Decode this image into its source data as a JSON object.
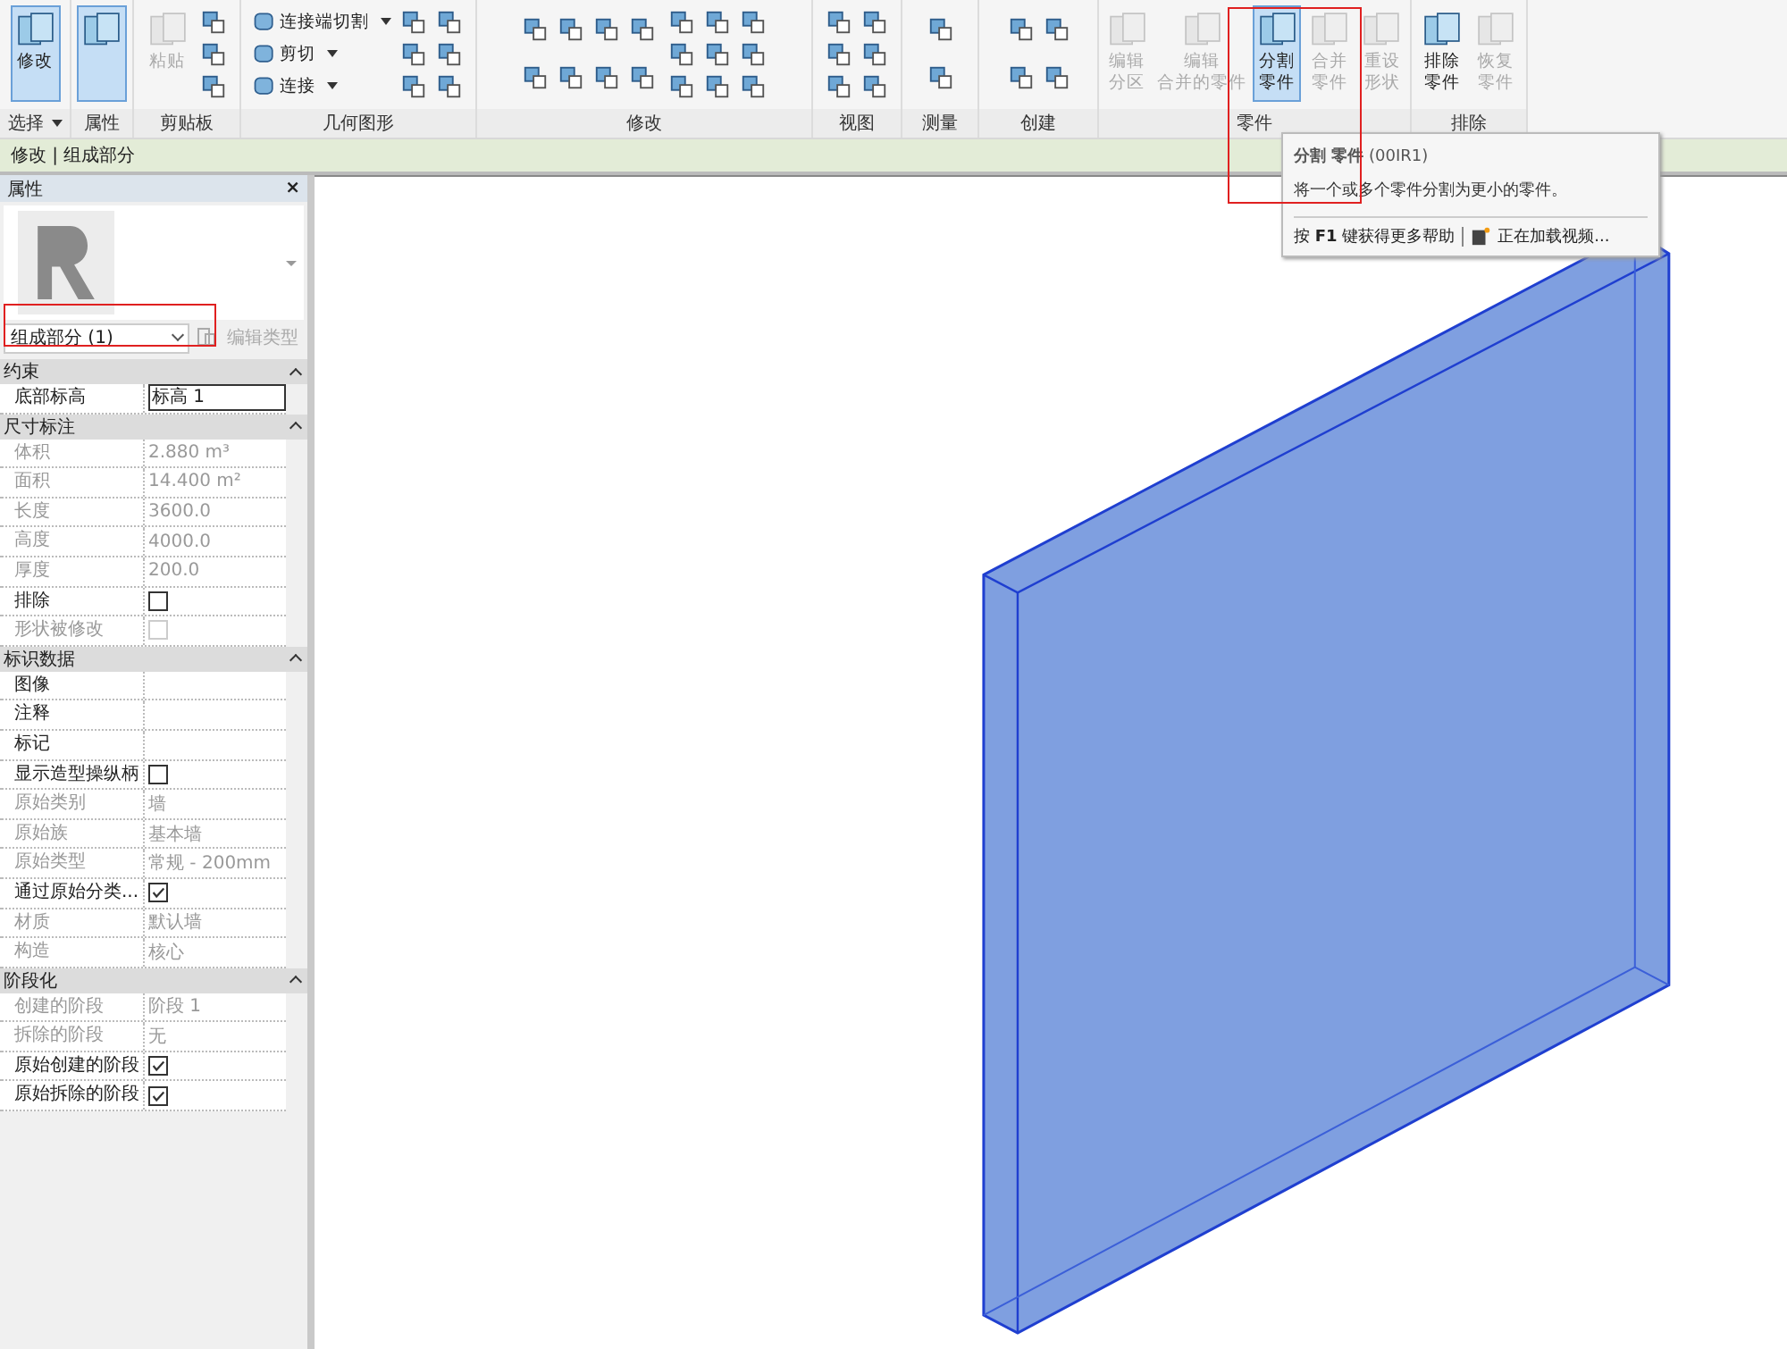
{
  "ribbon": {
    "groups": [
      {
        "label": "选择",
        "dropdown": true,
        "tools": [
          {
            "kind": "large",
            "lines": [
              "修改"
            ],
            "selected": true,
            "disabled": false
          }
        ]
      },
      {
        "label": "属性",
        "tools": [
          {
            "kind": "large",
            "selected": true,
            "disabled": false
          }
        ]
      },
      {
        "label": "剪贴板",
        "tools": [
          {
            "kind": "large",
            "lines": [
              "粘贴"
            ],
            "selected": false,
            "disabled": true
          }
        ]
      },
      {
        "label": "几何图形",
        "tools": [
          {
            "kind": "small",
            "items": [
              {
                "label": "连接端切割",
                "disabled": false
              },
              {
                "label": "剪切",
                "disabled": false
              },
              {
                "label": "连接",
                "disabled": false
              }
            ]
          }
        ]
      },
      {
        "label": "修改"
      },
      {
        "label": "视图"
      },
      {
        "label": "测量"
      },
      {
        "label": "创建"
      },
      {
        "label": "零件",
        "tools": [
          {
            "kind": "large",
            "lines": [
              "编辑",
              "分区"
            ],
            "selected": false,
            "disabled": true
          },
          {
            "kind": "large",
            "lines": [
              "编辑",
              "合并的零件"
            ],
            "selected": false,
            "disabled": true
          },
          {
            "kind": "large",
            "lines": [
              "分割",
              "零件"
            ],
            "selected": true,
            "disabled": false
          },
          {
            "kind": "large",
            "lines": [
              "合并",
              "零件"
            ],
            "selected": false,
            "disabled": true
          },
          {
            "kind": "large",
            "lines": [
              "重设",
              "形状"
            ],
            "selected": false,
            "disabled": true
          }
        ]
      },
      {
        "label": "排除",
        "tools": [
          {
            "kind": "large",
            "lines": [
              "排除",
              "零件"
            ],
            "selected": false,
            "disabled": false
          },
          {
            "kind": "large",
            "lines": [
              "恢复",
              "零件"
            ],
            "selected": false,
            "disabled": true
          }
        ]
      }
    ]
  },
  "context_bar": {
    "label": "修改 | 组成部分"
  },
  "tooltip": {
    "title": "**分割 零件** (00IR1)",
    "description": "将一个或多个零件分割为更小的零件。",
    "help": "按 **F1** 键获得更多帮助",
    "video": "正在加载视频..."
  },
  "properties": {
    "title": "属性",
    "close": "×",
    "type_selector": "组成部分 (1)",
    "edit_type": {
      "label": "编辑类型",
      "disabled": true
    },
    "sections": [
      {
        "title": "约束",
        "rows": [
          {
            "label": "底部标高",
            "kind": "input",
            "value": "标高 1",
            "disabled": false
          }
        ]
      },
      {
        "title": "尺寸标注",
        "rows": [
          {
            "label": "体积",
            "kind": "text",
            "value": "2.880 m³",
            "disabled": true
          },
          {
            "label": "面积",
            "kind": "text",
            "value": "14.400 m²",
            "disabled": true
          },
          {
            "label": "长度",
            "kind": "text",
            "value": "3600.0",
            "disabled": true
          },
          {
            "label": "高度",
            "kind": "text",
            "value": "4000.0",
            "disabled": true
          },
          {
            "label": "厚度",
            "kind": "text",
            "value": "200.0",
            "disabled": true
          },
          {
            "label": "排除",
            "kind": "checkbox",
            "checked": false,
            "disabled": false
          },
          {
            "label": "形状被修改",
            "kind": "checkbox",
            "checked": false,
            "disabled": true
          }
        ]
      },
      {
        "title": "标识数据",
        "rows": [
          {
            "label": "图像",
            "kind": "text",
            "value": "",
            "disabled": false
          },
          {
            "label": "注释",
            "kind": "text",
            "value": "",
            "disabled": false
          },
          {
            "label": "标记",
            "kind": "text",
            "value": "",
            "disabled": false
          },
          {
            "label": "显示造型操纵柄",
            "kind": "checkbox",
            "checked": false,
            "disabled": false
          },
          {
            "label": "原始类别",
            "kind": "text",
            "value": "墙",
            "disabled": true
          },
          {
            "label": "原始族",
            "kind": "text",
            "value": "基本墙",
            "disabled": true
          },
          {
            "label": "原始类型",
            "kind": "text",
            "value": "常规 - 200mm",
            "disabled": true
          },
          {
            "label": "通过原始分类...",
            "kind": "checkbox",
            "checked": true,
            "disabled": false
          },
          {
            "label": "材质",
            "kind": "text",
            "value": "默认墙",
            "disabled": true
          },
          {
            "label": "构造",
            "kind": "text",
            "value": "核心",
            "disabled": true
          }
        ]
      },
      {
        "title": "阶段化",
        "rows": [
          {
            "label": "创建的阶段",
            "kind": "text",
            "value": "阶段 1",
            "disabled": true
          },
          {
            "label": "拆除的阶段",
            "kind": "text",
            "value": "无",
            "disabled": true
          },
          {
            "label": "原始创建的阶段",
            "kind": "checkbox",
            "checked": true,
            "disabled": false
          },
          {
            "label": "原始拆除的阶段",
            "kind": "checkbox",
            "checked": true,
            "disabled": false
          }
        ]
      }
    ]
  }
}
